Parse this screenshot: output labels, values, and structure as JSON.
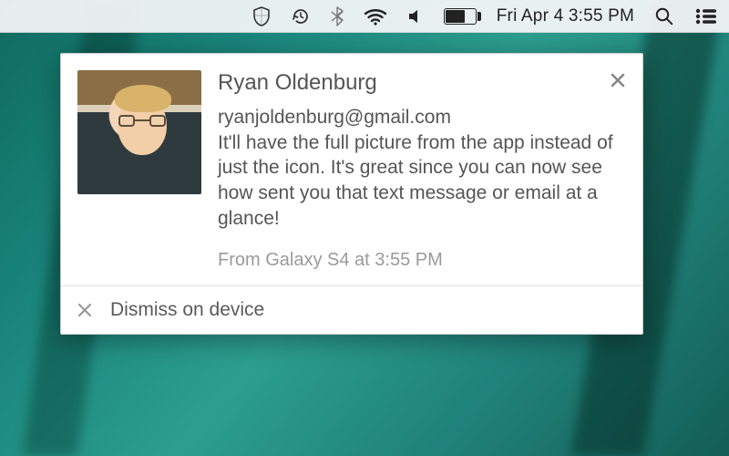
{
  "menubar": {
    "clock": "Fri Apr 4  3:55 PM",
    "icons": {
      "shield": "shield-icon",
      "timemachine": "clock-arrow-icon",
      "bluetooth": "bluetooth-icon",
      "wifi": "wifi-icon",
      "volume": "volume-icon",
      "battery": "battery-icon",
      "spotlight": "search-icon",
      "notifications": "list-icon"
    }
  },
  "notification": {
    "sender_name": "Ryan Oldenburg",
    "sender_email": "ryanjoldenburg@gmail.com",
    "message": "It'll have the full picture from the app instead of just the icon. It's great since you can now see how sent you that text message or email at a glance!",
    "source_line": "From Galaxy S4 at 3:55 PM",
    "dismiss_label": "Dismiss on device"
  }
}
